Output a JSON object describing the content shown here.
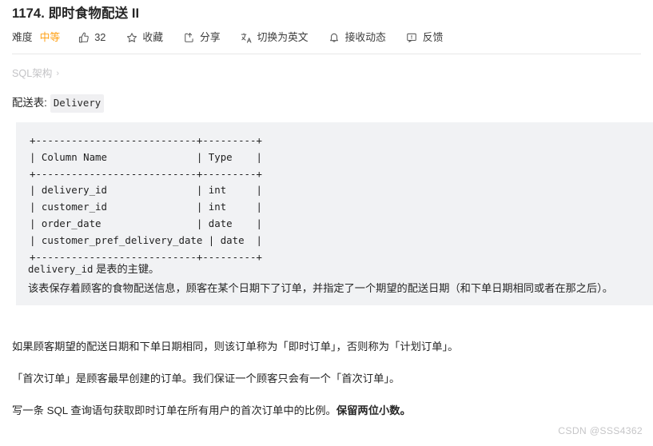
{
  "header": {
    "title": "1174. 即时食物配送 II"
  },
  "toolbar": {
    "difficulty_label": "难度",
    "difficulty_value": "中等",
    "difficulty_color": "#ffa116",
    "items": [
      {
        "icon": "thumbs-up-icon",
        "label": "32",
        "name": "like-button"
      },
      {
        "icon": "star-icon",
        "label": "收藏",
        "name": "favorite-button"
      },
      {
        "icon": "share-icon",
        "label": "分享",
        "name": "share-button"
      },
      {
        "icon": "translate-icon",
        "label": "切换为英文",
        "name": "translate-button"
      },
      {
        "icon": "bell-icon",
        "label": "接收动态",
        "name": "subscribe-button"
      },
      {
        "icon": "feedback-icon",
        "label": "反馈",
        "name": "feedback-button"
      }
    ]
  },
  "breadcrumb": {
    "label": "SQL架构",
    "separator": "›"
  },
  "schema": {
    "caption_label": "配送表:",
    "caption_code": "Delivery",
    "table_ascii": "+---------------------------+---------+\n| Column Name               | Type    |\n+---------------------------+---------+\n| delivery_id               | int     |\n| customer_id               | int     |\n| order_date                | date    |\n| customer_pref_delivery_date | date  |\n+---------------------------+---------+",
    "note_code": "delivery_id",
    "note_line1_rest": " 是表的主键。",
    "note_line2": "该表保存着顾客的食物配送信息，顾客在某个日期下了订单，并指定了一个期望的配送日期（和下单日期相同或者在那之后）。"
  },
  "body": {
    "paragraph1": "如果顾客期望的配送日期和下单日期相同，则该订单称为「即时订单」，否则称为「计划订单」。",
    "paragraph2": "「首次订单」是顾客最早创建的订单。我们保证一个顾客只会有一个「首次订单」。",
    "paragraph3_normal": "写一条 SQL 查询语句获取即时订单在所有用户的首次订单中的比例。",
    "paragraph3_bold": "保留两位小数。"
  },
  "watermark": {
    "text": "CSDN @SSS4362"
  }
}
